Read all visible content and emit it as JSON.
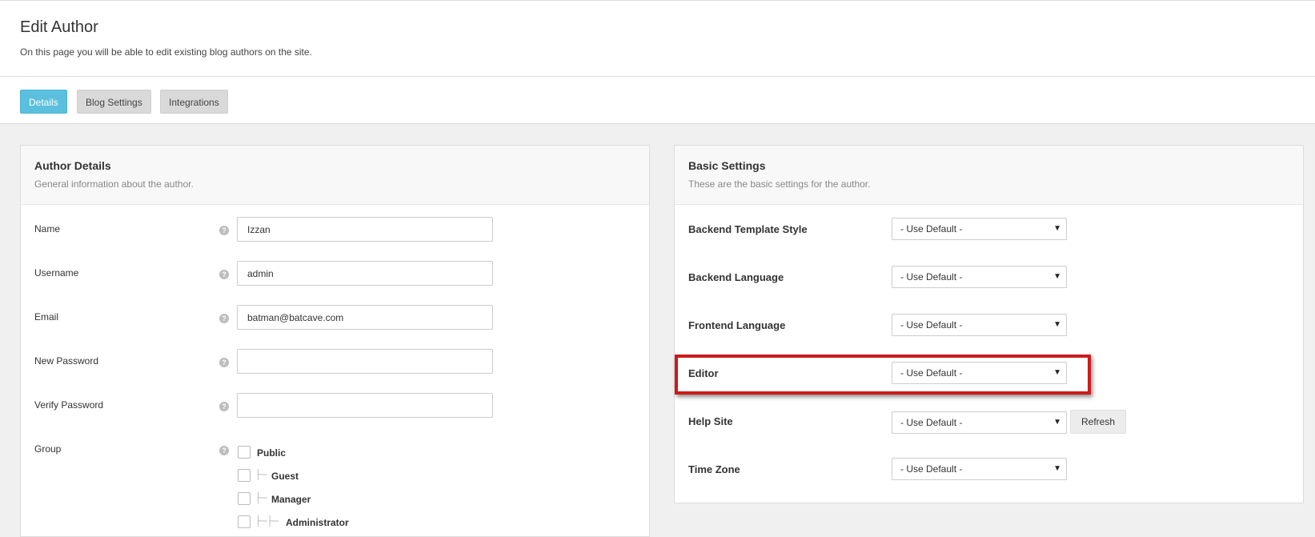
{
  "page": {
    "title": "Edit Author",
    "description": "On this page you will be able to edit existing blog authors on the site."
  },
  "tabs": [
    {
      "label": "Details",
      "active": true
    },
    {
      "label": "Blog Settings",
      "active": false
    },
    {
      "label": "Integrations",
      "active": false
    }
  ],
  "author_details": {
    "title": "Author Details",
    "subtitle": "General information about the author.",
    "fields": [
      {
        "label": "Name",
        "value": ""
      },
      {
        "label": "Username",
        "value": "admin"
      },
      {
        "label": "Email",
        "value": "batman@batcave.com"
      },
      {
        "label": "New Password",
        "value": ""
      },
      {
        "label": "Verify Password",
        "value": ""
      }
    ],
    "name_value": "Izzan",
    "group_label": "Group",
    "groups": [
      {
        "label": "Public",
        "checked": false
      },
      {
        "label": "Guest",
        "checked": false
      },
      {
        "label": "Manager",
        "checked": false
      },
      {
        "label": "Administrator",
        "checked": false
      }
    ]
  },
  "basic_settings": {
    "title": "Basic Settings",
    "subtitle": "These are the basic settings for the author.",
    "settings": [
      {
        "label": "Backend Template Style",
        "value": "- Use Default -"
      },
      {
        "label": "Backend Language",
        "value": "- Use Default -"
      },
      {
        "label": "Frontend Language",
        "value": "- Use Default -"
      },
      {
        "label": "Editor",
        "value": "- Use Default -"
      },
      {
        "label": "Help Site",
        "value": "- Use Default -"
      },
      {
        "label": "Time Zone",
        "value": "- Use Default -"
      }
    ],
    "refresh_label": "Refresh"
  },
  "highlight_color": "#cc1b1b",
  "accent_color": "#5bc0de"
}
